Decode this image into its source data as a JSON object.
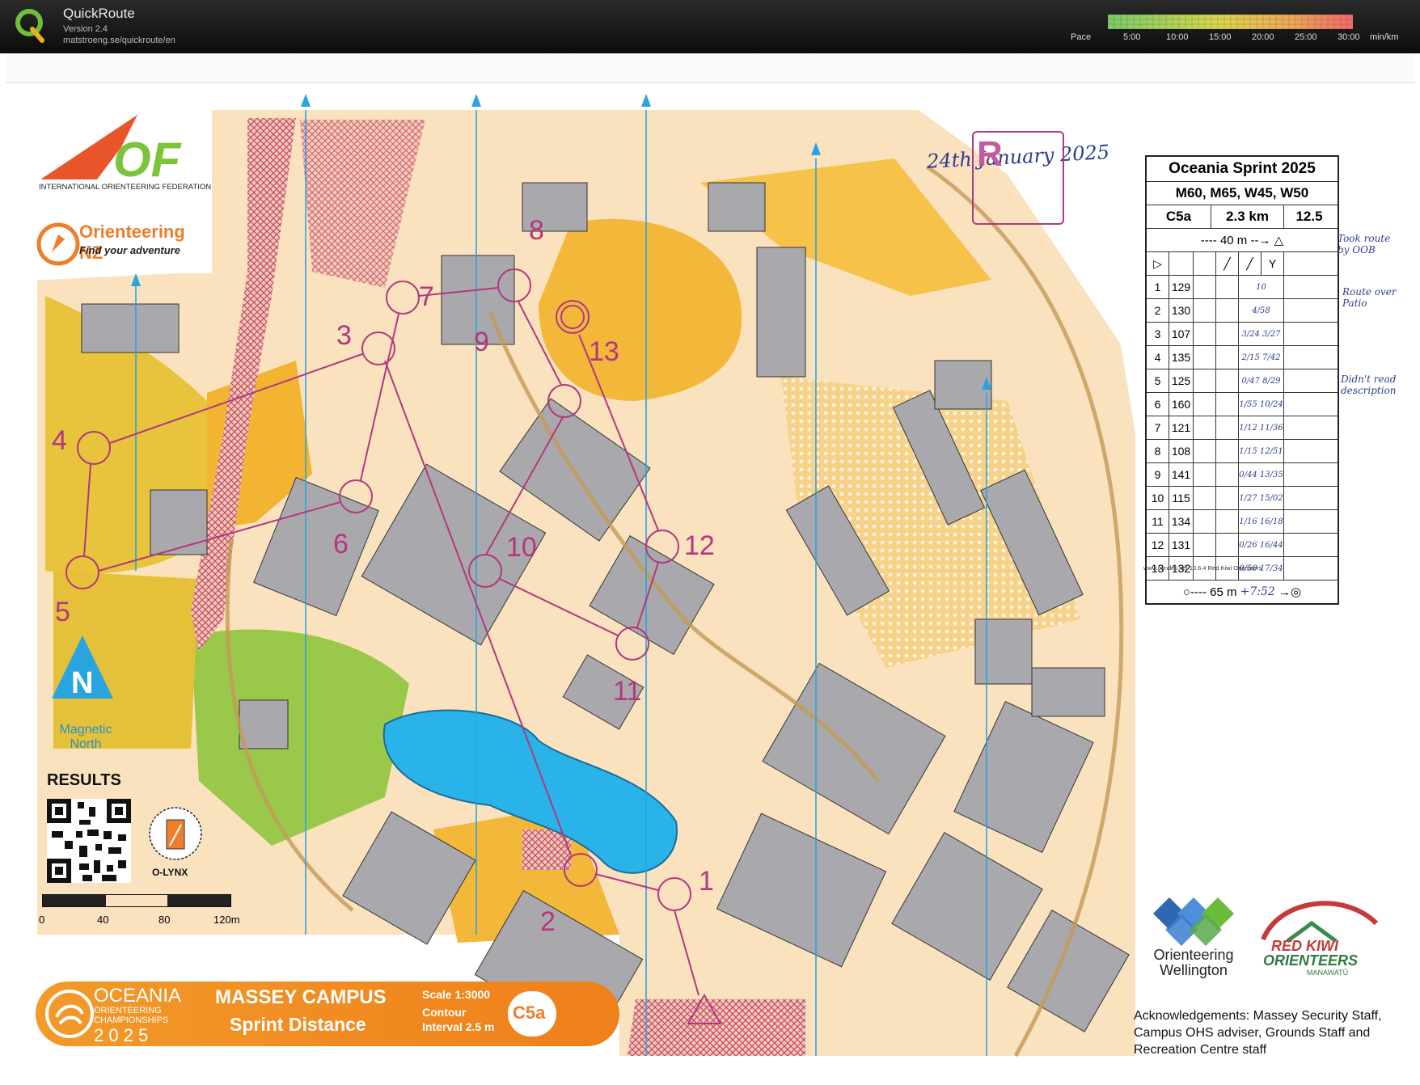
{
  "app": {
    "title": "QuickRoute",
    "version": "Version 2.4",
    "url": "matstroeng.se/quickroute/en",
    "pace_label": "Pace",
    "pace_ticks": [
      "5:00",
      "10:00",
      "15:00",
      "20:00",
      "25:00",
      "30:00"
    ],
    "pace_unit": "min/km",
    "colors": {
      "bar_bg": "#111111",
      "pace_low": "#8fd07a",
      "pace_mid": "#e6d34a",
      "pace_high": "#ef6b6b"
    }
  },
  "map": {
    "handwritten_date": "24th January 2025",
    "start_letter": "R",
    "event_title": "Oceania Sprint 2025",
    "classes": "M60, M65, W45, W50",
    "course": "C5a",
    "length": "2.3 km",
    "climb_or_extra": "12.5",
    "start_leg": "40 m",
    "finish_leg": "65 m",
    "finish_note": "+7:52",
    "controls": [
      {
        "n": "1",
        "code": "129"
      },
      {
        "n": "2",
        "code": "130"
      },
      {
        "n": "3",
        "code": "107"
      },
      {
        "n": "4",
        "code": "135"
      },
      {
        "n": "5",
        "code": "125"
      },
      {
        "n": "6",
        "code": "160"
      },
      {
        "n": "7",
        "code": "121"
      },
      {
        "n": "8",
        "code": "108"
      },
      {
        "n": "9",
        "code": "141"
      },
      {
        "n": "10",
        "code": "115"
      },
      {
        "n": "11",
        "code": "134"
      },
      {
        "n": "12",
        "code": "131"
      },
      {
        "n": "13",
        "code": "132"
      }
    ],
    "splits": [
      "10",
      "4/58",
      "3/24 3/27",
      "2/15 7/42",
      "0/47 8/29",
      "1/55 10/24",
      "1/12 11/36",
      "1/15 12/51",
      "0/44 13/35",
      "1/27 15/02",
      "1/16 16/18",
      "0/26 16/44",
      "0/50 17/34"
    ],
    "notes": [
      "Took route by OOB",
      "Route over Patio",
      "Didn't read description"
    ],
    "footer_line": "www.condes.net 10.6.4 Red Kiwi Orienteers",
    "control_numbers_on_map": [
      "1",
      "2",
      "3",
      "4",
      "5",
      "6",
      "7",
      "8",
      "9",
      "10",
      "11",
      "12",
      "13"
    ],
    "iof_text": "INTERNATIONAL ORIENTEERING FEDERATION",
    "nz_text": "Orienteering NZ",
    "nz_tagline": "Find your adventure",
    "north_label": "Magnetic North",
    "north_letter": "N",
    "results_label": "RESULTS",
    "olynx_label": "O-LYNX",
    "scalebar_ticks": [
      "0",
      "40",
      "80",
      "120m"
    ],
    "oc_brand_1": "OCEANIA",
    "oc_brand_2": "ORIENTEERING",
    "oc_brand_3": "CHAMPIONSHIPS",
    "oc_brand_4": "2 0 2 5",
    "venue": "MASSEY CAMPUS",
    "distance_type": "Sprint Distance",
    "scale_label": "Scale  1:3000",
    "contour_label": "Contour",
    "interval_label": "Interval  2.5 m",
    "course_badge": "C5a",
    "ow_text_1": "Orienteering",
    "ow_text_2": "Wellington",
    "rk_text_1": "RED KIWI",
    "rk_text_2": "ORIENTEERS",
    "rk_text_3": "MANAWATŪ",
    "acknowledgements": "Acknowledgements: Massey Security Staff, Campus OHS adviser, Grounds Staff and Recreation Centre staff"
  }
}
